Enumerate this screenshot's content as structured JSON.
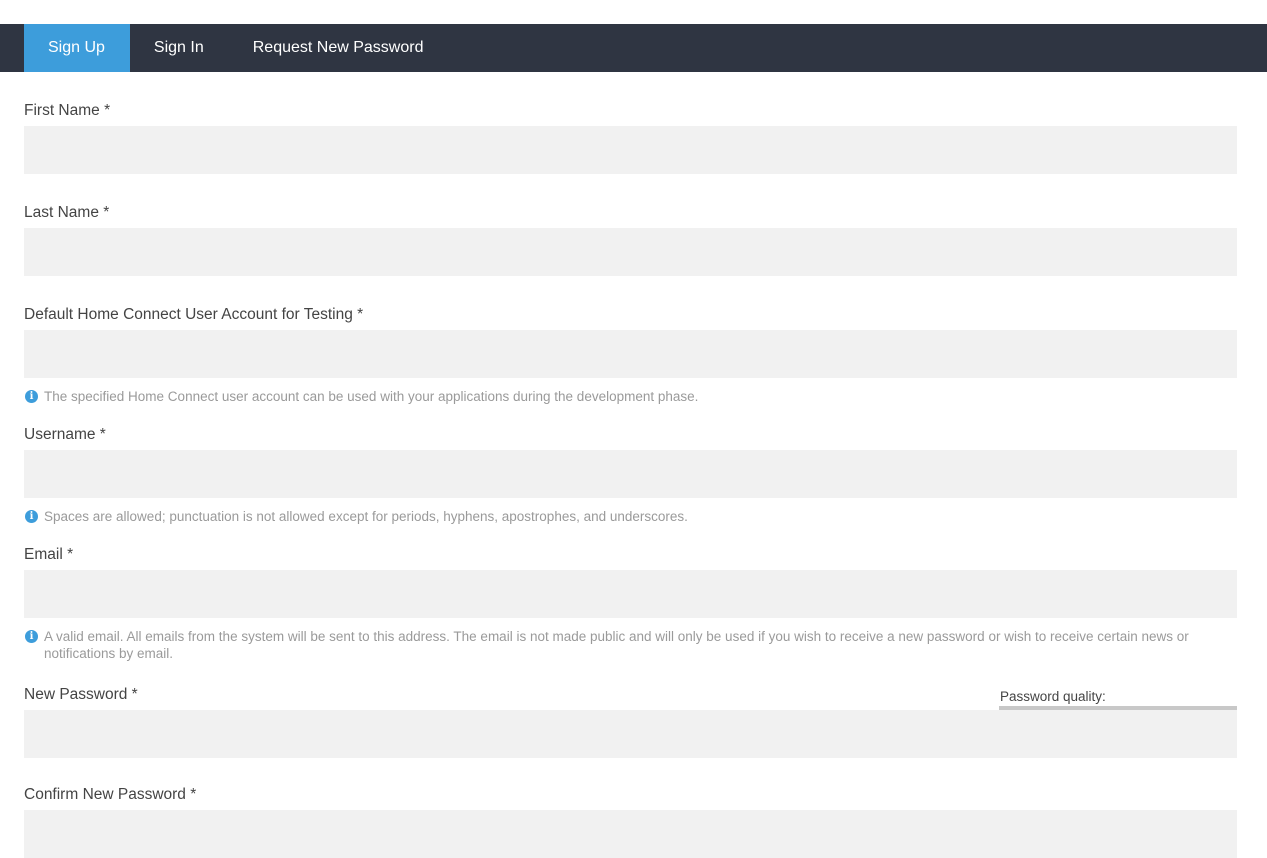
{
  "tabs": [
    {
      "label": "Sign Up",
      "active": true
    },
    {
      "label": "Sign In",
      "active": false
    },
    {
      "label": "Request New Password",
      "active": false
    }
  ],
  "form": {
    "first_name": {
      "label": "First Name *",
      "value": ""
    },
    "last_name": {
      "label": "Last Name *",
      "value": ""
    },
    "test_account": {
      "label": "Default Home Connect User Account for Testing *",
      "value": "",
      "help": "The specified Home Connect user account can be used with your applications during the development phase."
    },
    "username": {
      "label": "Username *",
      "value": "",
      "help": "Spaces are allowed; punctuation is not allowed except for periods, hyphens, apostrophes, and underscores."
    },
    "email": {
      "label": "Email *",
      "value": "",
      "help": "A valid email. All emails from the system will be sent to this address. The email is not made public and will only be used if you wish to receive a new password or wish to receive certain news or notifications by email."
    },
    "new_password": {
      "label": "New Password *",
      "value": "",
      "quality_label": "Password quality:",
      "quality_level": 0
    },
    "confirm_password": {
      "label": "Confirm New Password *",
      "value": ""
    }
  },
  "icons": {
    "info": "info-circle-icon"
  },
  "colors": {
    "nav_bg": "#2f3542",
    "accent": "#3d9ddb",
    "input_bg": "#f1f1f1",
    "help_text": "#9a9a9a"
  }
}
